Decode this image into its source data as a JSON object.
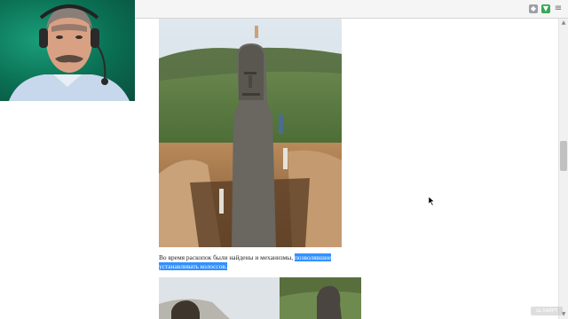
{
  "browser": {
    "toolbar_icons": [
      "shield-icon",
      "extension-icon",
      "menu-icon"
    ]
  },
  "article": {
    "caption_plain": "Во время раскопок были найдены и механизмы, ",
    "caption_highlighted": "позволявшие устанавливать колоссов."
  },
  "watermark": {
    "text": "Ш.ХАЙРТ"
  },
  "colors": {
    "selection": "#3390ff",
    "webcam_background": "#0f7a5e"
  }
}
